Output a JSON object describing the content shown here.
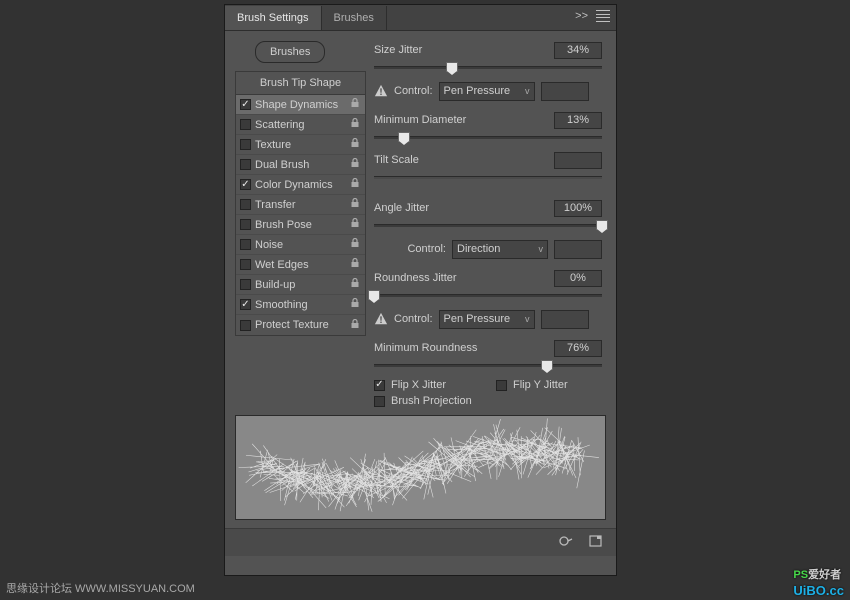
{
  "tabs": {
    "settings": "Brush Settings",
    "brushes": "Brushes"
  },
  "brushes_btn": "Brushes",
  "options_header": "Brush Tip Shape",
  "options": [
    {
      "label": "Shape Dynamics",
      "checked": true,
      "selected": true,
      "lock": true
    },
    {
      "label": "Scattering",
      "checked": false,
      "lock": true
    },
    {
      "label": "Texture",
      "checked": false,
      "lock": true
    },
    {
      "label": "Dual Brush",
      "checked": false,
      "lock": true
    },
    {
      "label": "Color Dynamics",
      "checked": true,
      "lock": true
    },
    {
      "label": "Transfer",
      "checked": false,
      "lock": true
    },
    {
      "label": "Brush Pose",
      "checked": false,
      "lock": true
    },
    {
      "label": "Noise",
      "checked": false,
      "lock": true
    },
    {
      "label": "Wet Edges",
      "checked": false,
      "lock": true
    },
    {
      "label": "Build-up",
      "checked": false,
      "lock": true
    },
    {
      "label": "Smoothing",
      "checked": true,
      "lock": true
    },
    {
      "label": "Protect Texture",
      "checked": false,
      "lock": true
    }
  ],
  "labels": {
    "size_jitter": "Size Jitter",
    "control": "Control:",
    "min_diameter": "Minimum Diameter",
    "tilt_scale": "Tilt Scale",
    "angle_jitter": "Angle Jitter",
    "roundness_jitter": "Roundness Jitter",
    "min_roundness": "Minimum Roundness",
    "flip_x": "Flip X Jitter",
    "flip_y": "Flip Y Jitter",
    "brush_projection": "Brush Projection"
  },
  "values": {
    "size_jitter": "34%",
    "size_jitter_pos": 34,
    "size_control": "Pen Pressure",
    "min_diameter": "13%",
    "min_diameter_pos": 13,
    "angle_jitter": "100%",
    "angle_jitter_pos": 100,
    "angle_control": "Direction",
    "roundness_jitter": "0%",
    "roundness_jitter_pos": 0,
    "roundness_control": "Pen Pressure",
    "min_roundness": "76%",
    "min_roundness_pos": 76,
    "flip_x": true,
    "flip_y": false,
    "brush_projection": false
  },
  "watermark_bl": "思缘设计论坛  WWW.MISSYUAN.COM",
  "watermark_br_left": "PS",
  "watermark_br_right": "爱好者",
  "watermark_br_sub": "UiBO.cc"
}
